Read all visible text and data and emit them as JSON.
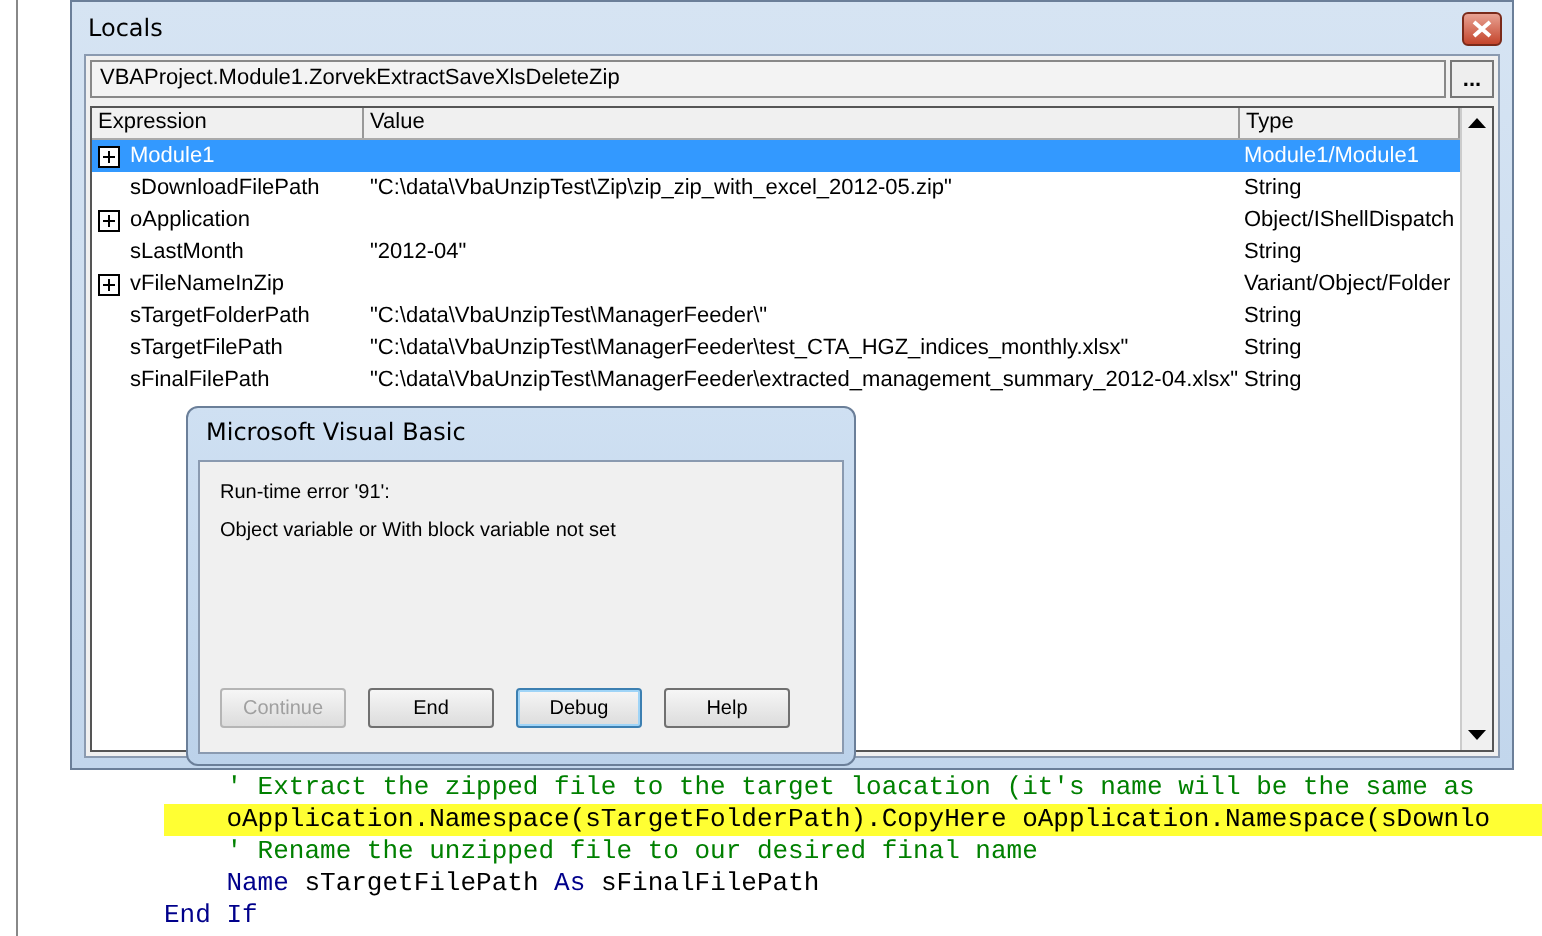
{
  "code_editor": {
    "lines": [
      {
        "highlighted": false,
        "tokens": [
          {
            "kind": "comment",
            "text": "    ' Extract the zipped file to the target loacation (it's name will be the same as"
          }
        ]
      },
      {
        "highlighted": true,
        "tokens": [
          {
            "kind": "plain",
            "text": "    oApplication.Namespace(sTargetFolderPath).CopyHere oApplication.Namespace(sDownlo"
          }
        ]
      },
      {
        "highlighted": false,
        "tokens": [
          {
            "kind": "comment",
            "text": "    ' Rename the unzipped file to our desired final name"
          }
        ]
      },
      {
        "highlighted": false,
        "tokens": [
          {
            "kind": "keyword",
            "text": "    Name"
          },
          {
            "kind": "plain",
            "text": " sTargetFilePath "
          },
          {
            "kind": "keyword",
            "text": "As"
          },
          {
            "kind": "plain",
            "text": " sFinalFilePath"
          }
        ]
      },
      {
        "highlighted": false,
        "tokens": [
          {
            "kind": "keyword",
            "text": "End If"
          }
        ]
      }
    ]
  },
  "locals_window": {
    "title": "Locals",
    "context": "VBAProject.Module1.ZorvekExtractSaveXlsDeleteZip",
    "context_button": "...",
    "columns": [
      "Expression",
      "Value",
      "Type"
    ],
    "rows": [
      {
        "expression": "Module1",
        "value": "",
        "type": "Module1/Module1",
        "expandable": true,
        "selected": true
      },
      {
        "expression": "sDownloadFilePath",
        "value": "\"C:\\data\\VbaUnzipTest\\Zip\\zip_zip_with_excel_2012-05.zip\"",
        "type": "String",
        "expandable": false,
        "selected": false
      },
      {
        "expression": "oApplication",
        "value": "",
        "type": "Object/IShellDispatch",
        "expandable": true,
        "selected": false
      },
      {
        "expression": "sLastMonth",
        "value": "\"2012-04\"",
        "type": "String",
        "expandable": false,
        "selected": false
      },
      {
        "expression": "vFileNameInZip",
        "value": "",
        "type": "Variant/Object/Folder",
        "expandable": true,
        "selected": false
      },
      {
        "expression": "sTargetFolderPath",
        "value": "\"C:\\data\\VbaUnzipTest\\ManagerFeeder\\\"",
        "type": "String",
        "expandable": false,
        "selected": false
      },
      {
        "expression": "sTargetFilePath",
        "value": "\"C:\\data\\VbaUnzipTest\\ManagerFeeder\\test_CTA_HGZ_indices_monthly.xlsx\"",
        "type": "String",
        "expandable": false,
        "selected": false
      },
      {
        "expression": "sFinalFilePath",
        "value": "\"C:\\data\\VbaUnzipTest\\ManagerFeeder\\extracted_management_summary_2012-04.xlsx\"",
        "type": "String",
        "expandable": false,
        "selected": false
      }
    ]
  },
  "error_dialog": {
    "title": "Microsoft Visual Basic",
    "error": "Run-time error '91':",
    "message": "Object variable or With block variable not set",
    "buttons": [
      {
        "label": "Continue",
        "disabled": true,
        "focused": false
      },
      {
        "label": "End",
        "disabled": false,
        "focused": false
      },
      {
        "label": "Debug",
        "disabled": false,
        "focused": true
      },
      {
        "label": "Help",
        "disabled": false,
        "focused": false
      }
    ]
  }
}
